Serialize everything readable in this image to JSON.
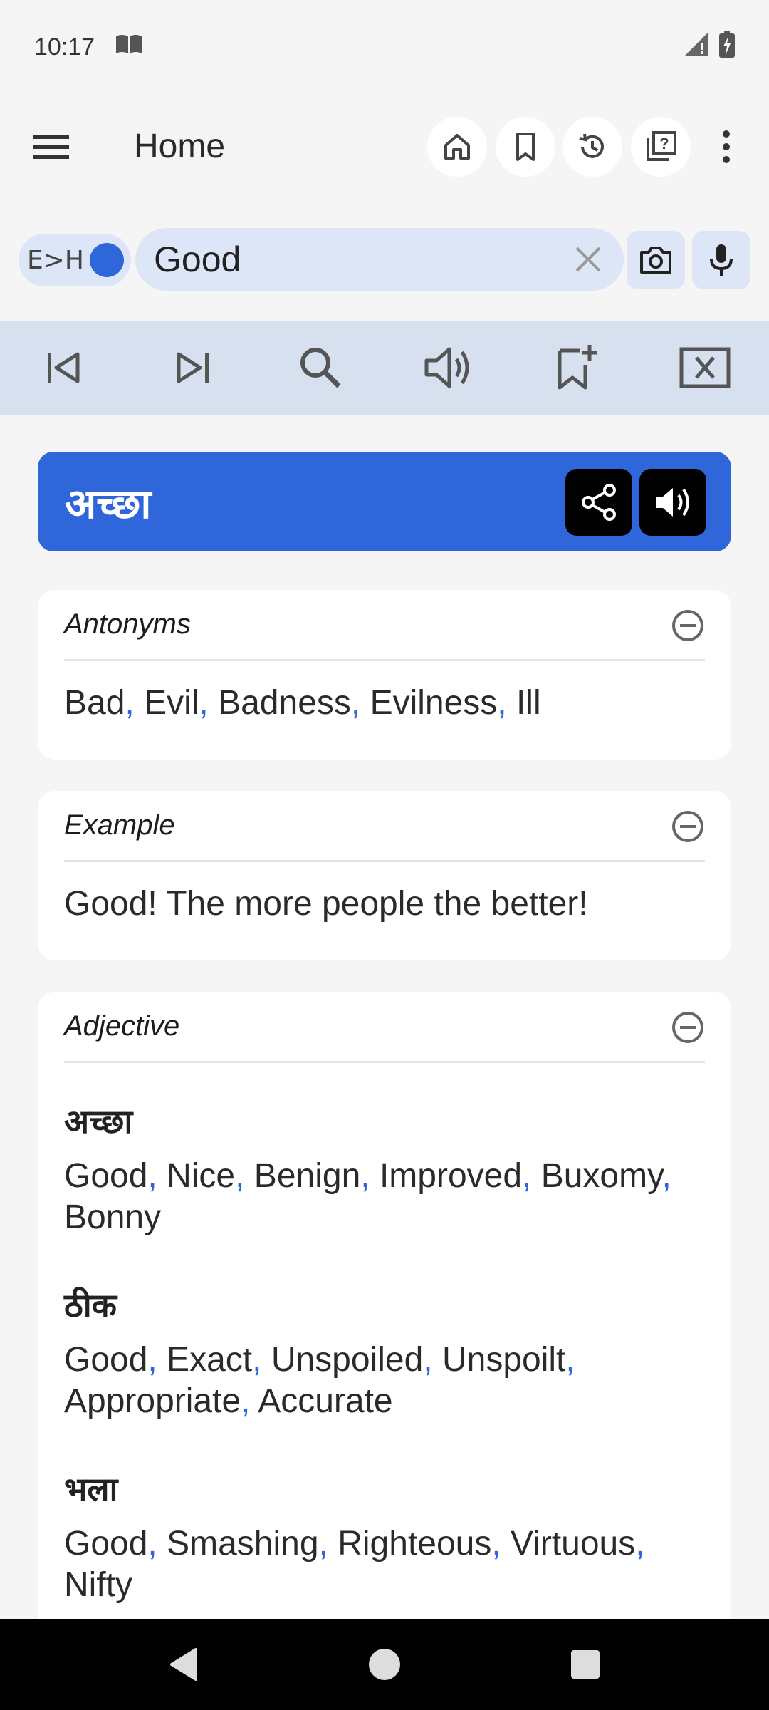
{
  "status_bar": {
    "time": "10:17",
    "icons": [
      "book-icon",
      "signal-icon",
      "battery-charging-icon"
    ]
  },
  "app_bar": {
    "title": "Home",
    "actions": [
      "home-icon",
      "bookmark-icon",
      "history-icon",
      "quiz-icon",
      "more-vert-icon"
    ]
  },
  "search": {
    "direction_label": "E>H",
    "query": "Good",
    "placeholder": ""
  },
  "toolbar": {
    "tools": [
      "skip-previous-icon",
      "skip-next-icon",
      "search-icon",
      "volume-icon",
      "bookmark-add-icon",
      "close-box-icon"
    ]
  },
  "headword": {
    "text": "अच्छा"
  },
  "antonyms": {
    "title": "Antonyms",
    "items": [
      "Bad",
      "Evil",
      "Badness",
      "Evilness",
      "Ill"
    ]
  },
  "example": {
    "title": "Example",
    "text": "Good! The more people the better!"
  },
  "adjective": {
    "title": "Adjective",
    "senses": [
      {
        "word": "अच्छा",
        "line1": [
          "Good",
          "Nice",
          "Benign",
          "Improved",
          "Buxomy"
        ],
        "line2": [
          "Bonny"
        ]
      },
      {
        "word": "ठीक",
        "line1": [
          "Good",
          "Exact",
          "Unspoiled",
          "Unspoilt"
        ],
        "line2": [
          "Appropriate",
          "Accurate"
        ]
      },
      {
        "word": "भला",
        "line1": [
          "Good",
          "Smashing",
          "Righteous",
          "Virtuous"
        ],
        "line2": [
          "Nifty"
        ]
      }
    ]
  },
  "colors": {
    "accent": "#2f66d9",
    "toolbar_bg": "#d6e0ee",
    "pill_bg": "#dde6f6",
    "page_bg": "#f5f5f5"
  }
}
